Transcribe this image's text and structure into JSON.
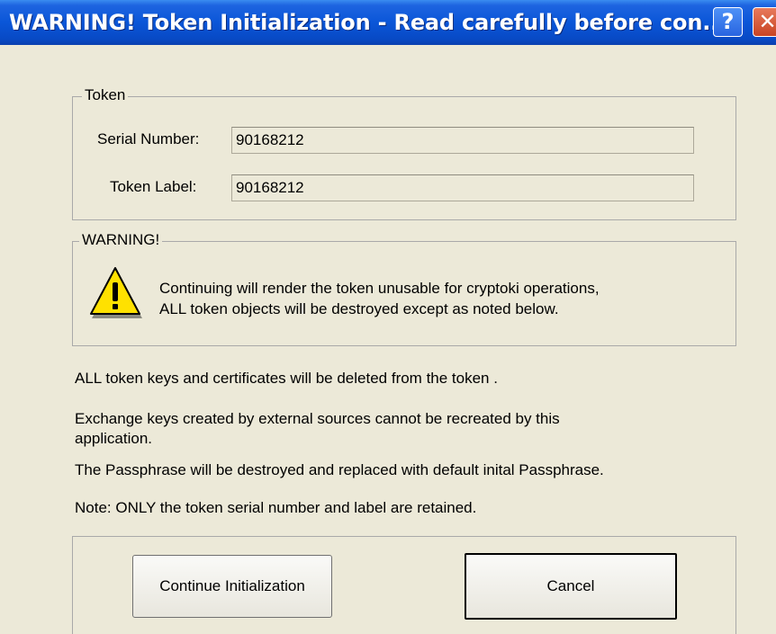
{
  "window": {
    "title": "WARNING!  Token Initialization  - Read carefully before con...",
    "help_glyph": "?",
    "close_glyph": "✕"
  },
  "token_group": {
    "legend": "Token",
    "serial_label": "Serial Number:",
    "serial_value": "90168212",
    "label_label": "Token Label:",
    "label_value": "90168212"
  },
  "warning_group": {
    "legend": "WARNING!",
    "icon": "warning-triangle-icon",
    "line1": "Continuing will render the token unusable for cryptoki operations,",
    "line2": "ALL token objects will be destroyed except as noted below."
  },
  "messages": {
    "m1": "ALL token keys and certificates will be deleted from the token .",
    "m2a": "Exchange keys created by external sources cannot be recreated by this",
    "m2b": "application.",
    "m3": "The Passphrase will be destroyed and replaced with default inital Passphrase.",
    "m4": "Note: ONLY the token serial number and label are retained."
  },
  "buttons": {
    "continue": "Continue Initialization",
    "cancel": "Cancel"
  },
  "colors": {
    "title_bar": "#0a56d8",
    "dialog_bg": "#ece9d8",
    "warning_icon": "#ffe100"
  }
}
